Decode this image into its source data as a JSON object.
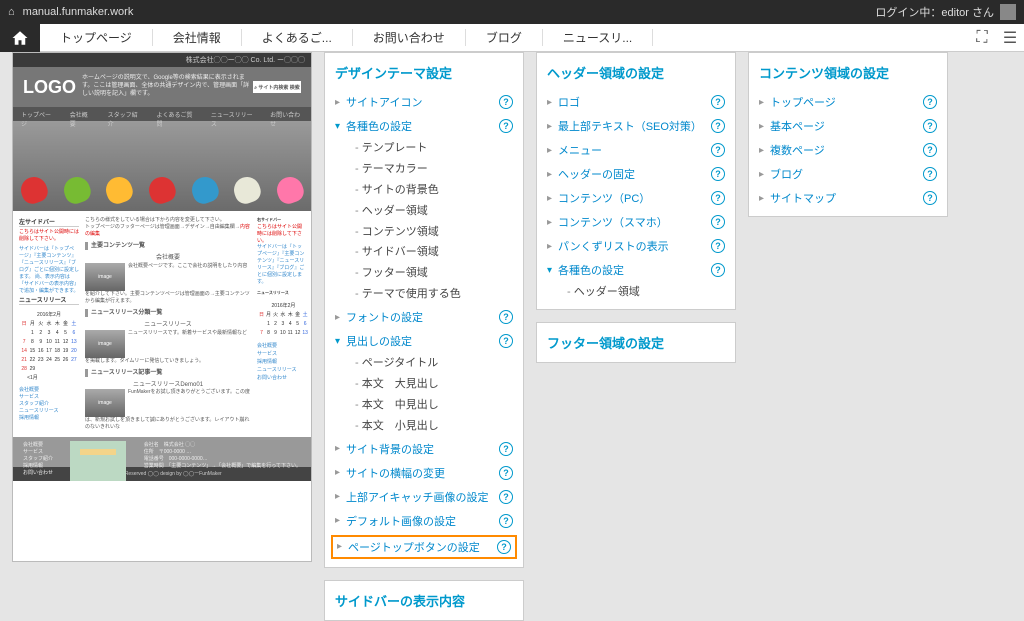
{
  "topbar": {
    "home_icon": "home-icon",
    "url": "manual.funmaker.work",
    "login_text": "ログイン中：editor さん"
  },
  "nav": {
    "items": [
      "トップページ",
      "会社情報",
      "よくあるご...",
      "お問い合わせ",
      "ブログ",
      "ニュースリ..."
    ]
  },
  "preview": {
    "logo": "LOGO",
    "top_co": "株式会社◯◯ー◯◯ Co. Ltd. ー◯◯◯",
    "search_btn": "⌕ サイト内検索   検索",
    "nav_items": [
      "トップページ",
      "会社概要",
      "スタッフ紹介",
      "よくあるご質問",
      "ニュースリリース",
      "お問い合わせ"
    ],
    "left_side_title": "左サイドバー",
    "left_red": "こちらはサイト公開時には削除して下さい。",
    "left_blue": "サイドバーは『トップページ』『主要コンテンツ』『ニュースリリース』『ブログ』ごとに個別に設定します。\n尚、表示内容は『サイドバーの表示内容』で追加・編集ができます。",
    "main1_title": "主要コンテンツ一覧",
    "main1_sub": "会社概要",
    "main1_txt": "会社概要ページです。ここで会社の説明をしたり内容を紹介して下さい。主要コンテンツページは管理画面の→主要コンテンツから編集が行えます。",
    "main2_title": "ニュースリリース分類一覧",
    "main2_sub": "ニュースリリース",
    "main2_txt": "ニュースリリースです。新着サービスや最新情報などを掲載します。タイムリーに発信していきましょう。",
    "main3_title": "ニュースリリース記事一覧",
    "main3_sub": "ニュースリリースDemo01",
    "main3_txt": "FunMakerをお試し頂きありがとうございます。この度は、新規お試しを頂きまして誠にありがとうございます。レイアウト崩れのないきれいな",
    "right_side_title": "右サイドバー",
    "right_red": "こちらはサイト公開時には削除して下さい。",
    "right_txt": "サイドバーは『トップページ』『主要コンテンツ』『ニュースリリース』『ブログ』ごとに個別に設定します。",
    "cal_title": "ニュースリリース",
    "cal_month": "2016年2月",
    "menu_items": [
      "会社概要",
      "サービス",
      "スタッフ紹介",
      "ニュースリリース",
      "採用情報"
    ],
    "menu_items_r": [
      "会社概要",
      "サービス",
      "採用情報",
      "ニュースリリース",
      "お問い合わせ"
    ],
    "foot_labels": [
      "会社概要",
      "サービス",
      "スタッフ紹介",
      "採用情報",
      "お問い合わせ"
    ],
    "foot_info_labels": [
      "会社名",
      "住所",
      "電話番号",
      "営業時間"
    ],
    "foot_info_vals": [
      "株式会社 ◯◯",
      "〒000-0000 …",
      "000-0000-0000…",
      "「主要コンテンツ」→「会社概要」で編集を行って下さい。"
    ],
    "copyright": "All Rights Reserved ◯◯   design by ◯◯ーFunMaker"
  },
  "panel_design": {
    "title": "デザインテーマ設定",
    "items": [
      {
        "label": "サイトアイコン",
        "help": true
      },
      {
        "label": "各種色の設定",
        "help": true,
        "open": true,
        "subs": [
          "テンプレート",
          "テーマカラー",
          "サイトの背景色",
          "ヘッダー領域",
          "コンテンツ領域",
          "サイドバー領域",
          "フッター領域",
          "テーマで使用する色"
        ]
      },
      {
        "label": "フォントの設定",
        "help": true
      },
      {
        "label": "見出しの設定",
        "help": true,
        "open": true,
        "subs": [
          "ページタイトル",
          "本文　大見出し",
          "本文　中見出し",
          "本文　小見出し"
        ]
      },
      {
        "label": "サイト背景の設定",
        "help": true
      },
      {
        "label": "サイトの横幅の変更",
        "help": true
      },
      {
        "label": "上部アイキャッチ画像の設定",
        "help": true
      },
      {
        "label": "デフォルト画像の設定",
        "help": true
      },
      {
        "label": "ページトップボタンの設定",
        "help": true,
        "highlight": true
      }
    ],
    "footer_title": "サイドバーの表示内容"
  },
  "panel_header": {
    "title": "ヘッダー領域の設定",
    "items": [
      {
        "label": "ロゴ",
        "help": true
      },
      {
        "label": "最上部テキスト（SEO対策）",
        "help": true
      },
      {
        "label": "メニュー",
        "help": true
      },
      {
        "label": "ヘッダーの固定",
        "help": true
      },
      {
        "label": "コンテンツ（PC）",
        "help": true
      },
      {
        "label": "コンテンツ（スマホ）",
        "help": true
      },
      {
        "label": "パンくずリストの表示",
        "help": true
      },
      {
        "label": "各種色の設定",
        "help": true,
        "open": true,
        "subs": [
          "ヘッダー領域"
        ]
      }
    ],
    "footer_title": "フッター領域の設定"
  },
  "panel_content": {
    "title": "コンテンツ領域の設定",
    "items": [
      {
        "label": "トップページ",
        "help": true
      },
      {
        "label": "基本ページ",
        "help": true
      },
      {
        "label": "複数ページ",
        "help": true
      },
      {
        "label": "ブログ",
        "help": true
      },
      {
        "label": "サイトマップ",
        "help": true
      }
    ]
  }
}
